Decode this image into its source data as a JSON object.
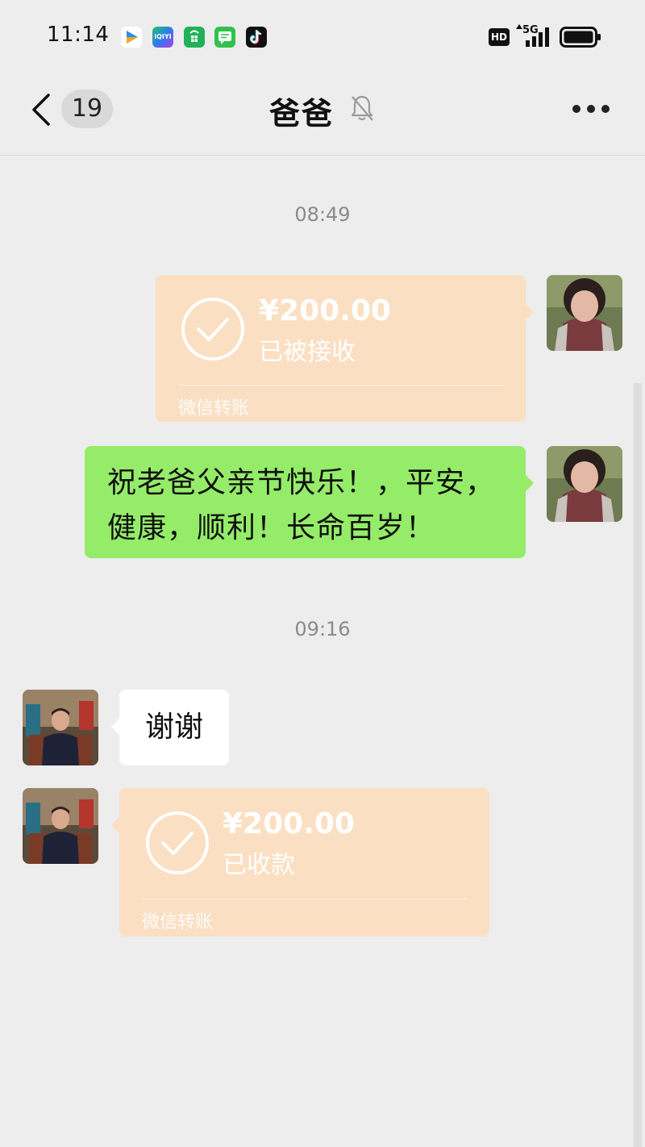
{
  "status_bar": {
    "time": "11:14",
    "apps": [
      "video-app-icon",
      "iqiyi-icon",
      "app-store-icon",
      "messages-icon",
      "tiktok-icon"
    ],
    "iqiyi_text": "iQIYI",
    "hd": "HD",
    "network": "5G"
  },
  "nav": {
    "unread_count": "19",
    "title": "爸爸"
  },
  "colors": {
    "background": "#ededed",
    "transfer_bubble": "#fadfc2",
    "text_bubble_self": "#95ec69",
    "text_bubble_other": "#ffffff"
  },
  "messages": {
    "time1": "08:49",
    "transfer1": {
      "amount": "¥200.00",
      "status": "已被接收",
      "footer": "微信转账"
    },
    "text1_line1": "祝老爸父亲节快乐！，平安，",
    "text1_line2": "健康，顺利！长命百岁！",
    "time2": "09:16",
    "reply": "谢谢",
    "transfer2": {
      "amount": "¥200.00",
      "status": "已收款",
      "footer": "微信转账"
    }
  }
}
